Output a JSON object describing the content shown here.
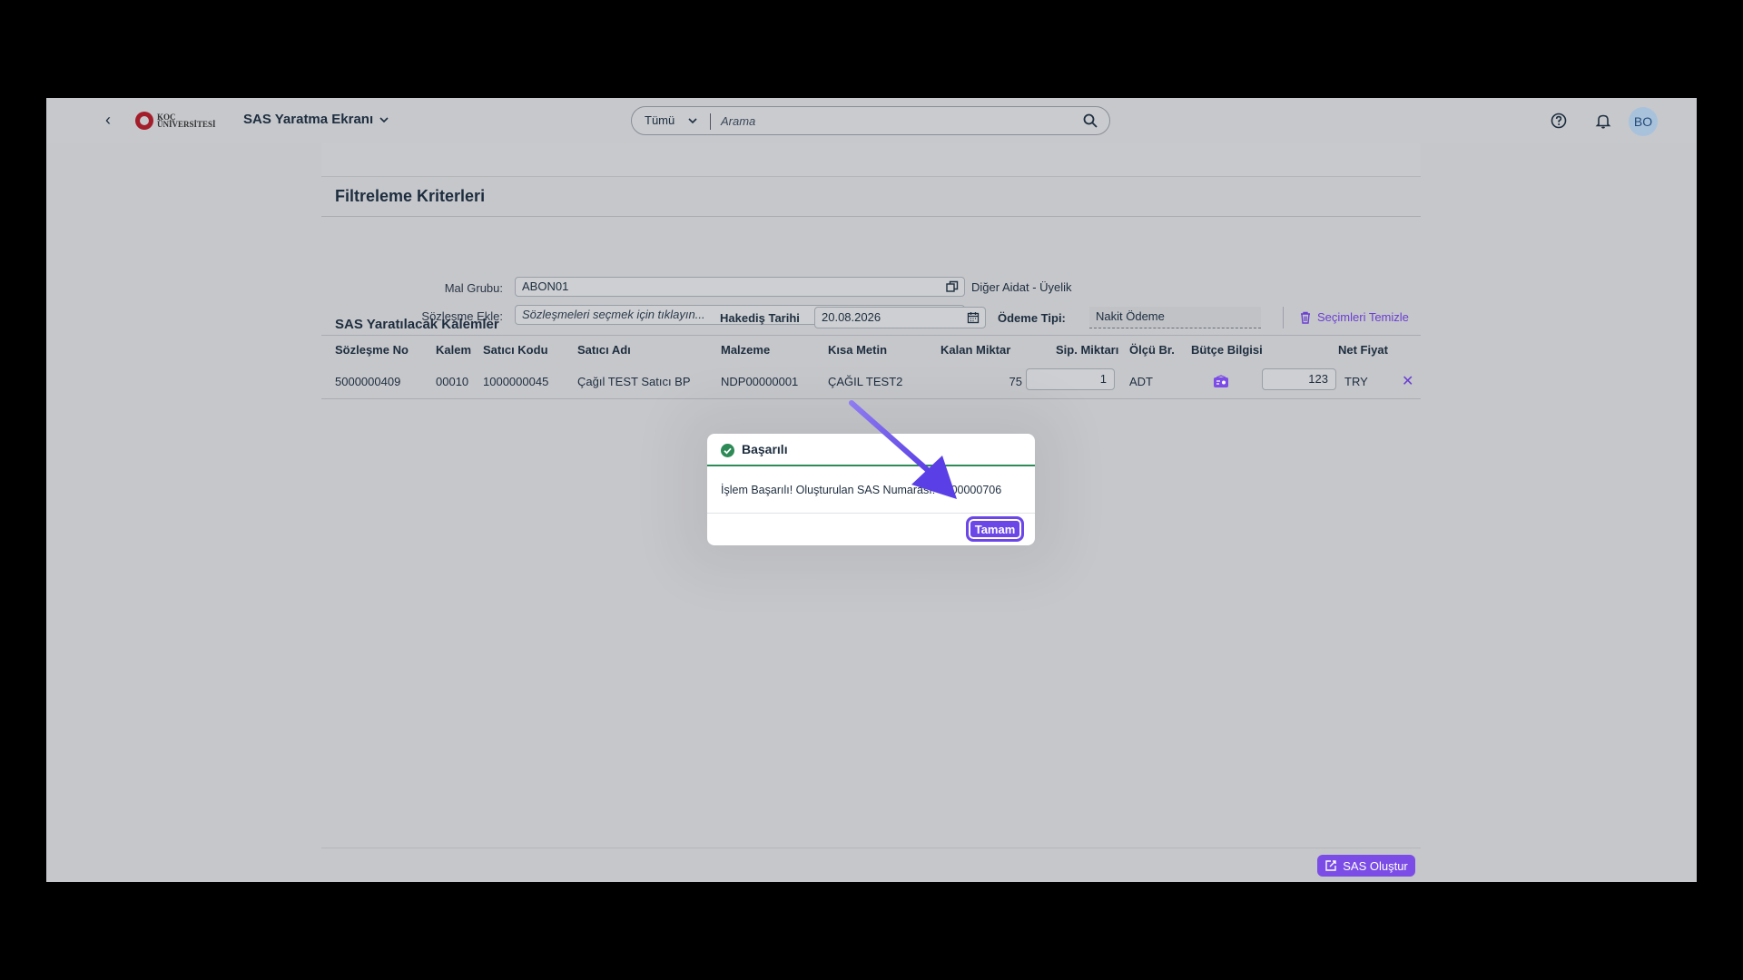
{
  "shell": {
    "logo_line1": "KOÇ",
    "logo_line2": "ÜNİVERSİTESİ",
    "title": "SAS Yaratma Ekranı",
    "search_scope": "Tümü",
    "search_placeholder": "Arama",
    "avatar": "BO"
  },
  "filter": {
    "title": "Filtreleme Kriterleri",
    "mal_grubu_label": "Mal Grubu:",
    "mal_grubu_value": "ABON01",
    "mal_grubu_desc": "Diğer Aidat - Üyelik",
    "sozlesme_label": "Sözleşme Ekle:",
    "sozlesme_placeholder": "Sözleşmeleri seçmek için tıklayın..."
  },
  "items": {
    "title": "SAS Yaratılacak Kalemler",
    "hakedis_label": "Hakediş Tarihi",
    "hakedis_value": "20.08.2026",
    "odeme_label": "Ödeme Tipi:",
    "odeme_value": "Nakit Ödeme",
    "clear_label": "Seçimleri Temizle",
    "columns": [
      "Sözleşme No",
      "Kalem",
      "Satıcı Kodu",
      "Satıcı Adı",
      "Malzeme",
      "Kısa Metin",
      "Kalan Miktar",
      "Sip. Miktarı",
      "Ölçü Br.",
      "Bütçe Bilgisi",
      "Net Fiyat"
    ],
    "rows": [
      {
        "sozlesme_no": "5000000409",
        "kalem": "00010",
        "satici_kodu": "1000000045",
        "satici_adi": "Çağıl TEST Satıcı BP",
        "malzeme": "NDP00000001",
        "kisa_metin": "ÇAĞIL TEST2",
        "kalan_miktar": "75",
        "sip_miktari": "1",
        "olcu_br": "ADT",
        "net_fiyat": "123",
        "currency": "TRY"
      }
    ]
  },
  "footer": {
    "create_label": "SAS Oluştur"
  },
  "dialog": {
    "title": "Başarılı",
    "message": "İşlem Başarılı! Oluşturulan SAS Numarası: 4800000706",
    "ok_label": "Tamam"
  },
  "colors": {
    "accent": "#6b47e8",
    "success": "#2e8b57",
    "brand": "#a31d2a"
  }
}
